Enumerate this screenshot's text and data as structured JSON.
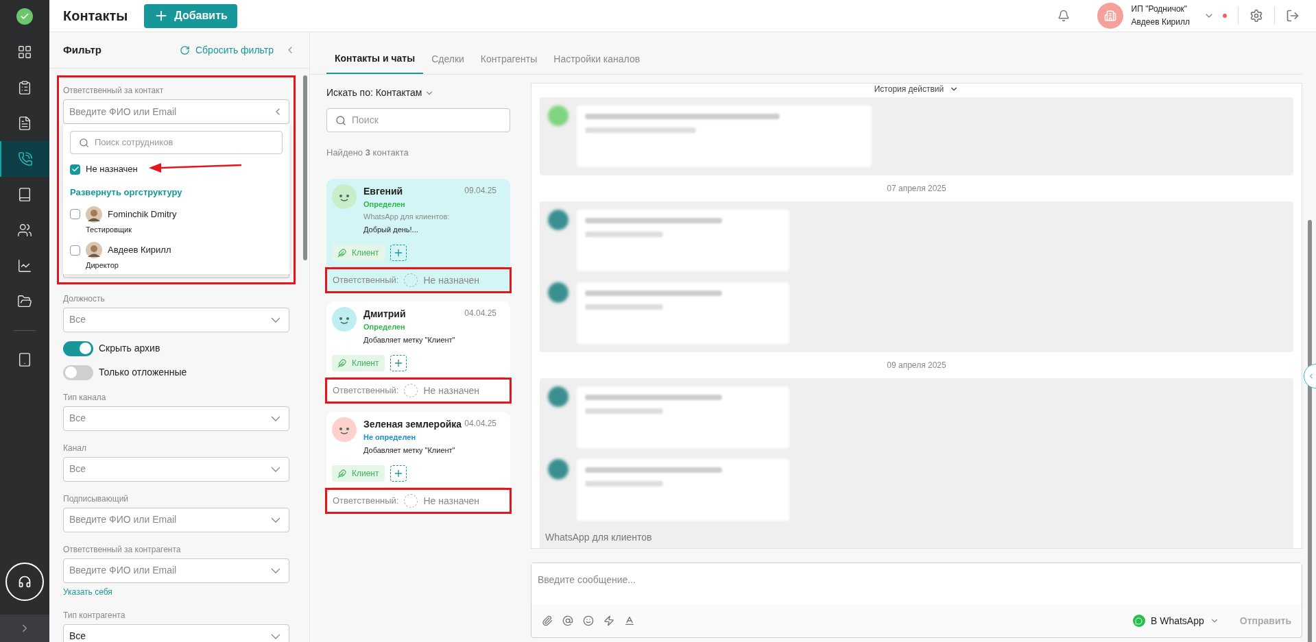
{
  "nav": [
    {
      "kind": "grid",
      "selected": false
    },
    {
      "kind": "clipboard",
      "selected": false
    },
    {
      "kind": "document",
      "selected": false
    },
    {
      "kind": "phone",
      "selected": true
    },
    {
      "kind": "book",
      "selected": false
    },
    {
      "kind": "people",
      "selected": false
    },
    {
      "kind": "chart",
      "selected": false
    },
    {
      "kind": "folder",
      "selected": false
    },
    {
      "kind": "tablet",
      "selected": false
    }
  ],
  "header": {
    "title": "Контакты",
    "add_button": "Добавить",
    "company": "ИП \"Родничок\"",
    "user": "Авдеев Кирилл",
    "notification_dot": true
  },
  "filter": {
    "title": "Фильтр",
    "reset": "Сбросить фильтр",
    "responsible": {
      "label": "Ответственный за контакт",
      "placeholder": "Введите ФИО или Email",
      "search_placeholder": "Поиск сотрудников",
      "unassigned": {
        "label": "Не назначен",
        "checked": true
      },
      "expand_link": "Развернуть оргструктуру",
      "employees": [
        {
          "name": "Fominchik Dmitry",
          "role": "Тестировщик",
          "checked": false
        },
        {
          "name": "Авдеев Кирилл",
          "role": "Директор",
          "checked": false
        }
      ]
    },
    "fields": [
      {
        "kind": "select",
        "label": "Должность",
        "value": "Все"
      },
      {
        "kind": "toggle",
        "label": "Скрыть архив",
        "on": true
      },
      {
        "kind": "toggle",
        "label": "Только отложенные",
        "on": false
      },
      {
        "kind": "select",
        "label": "Тип канала",
        "value": "Все"
      },
      {
        "kind": "select",
        "label": "Канал",
        "value": "Все"
      },
      {
        "kind": "user",
        "label": "Подписывающий",
        "placeholder": "Введите ФИО или Email"
      },
      {
        "kind": "user",
        "label": "Ответственный за контрагента",
        "placeholder": "Введите ФИО или Email",
        "link": "Указать себя"
      },
      {
        "kind": "select",
        "label": "Тип контрагента",
        "value": "Все"
      }
    ]
  },
  "tabs": [
    {
      "label": "Контакты и чаты",
      "selected": true
    },
    {
      "label": "Сделки",
      "selected": false
    },
    {
      "label": "Контрагенты",
      "selected": false
    },
    {
      "label": "Настройки каналов",
      "selected": false
    }
  ],
  "search_by": "Искать по: Контактам",
  "search_placeholder": "Поиск",
  "found": "Найдено **3** контакта",
  "contacts": [
    {
      "name": "Евгений",
      "status": {
        "text": "Определен",
        "color": "#2fb84a"
      },
      "channel": "WhatsApp для клиентов:",
      "preview": "Добрый день!...",
      "date": "09.04.25",
      "selected": true,
      "avatar": {
        "color": "#c9ecc9"
      },
      "tag": "Клиент",
      "responsible_label": "Ответственный:",
      "responsible": "Не назначен"
    },
    {
      "name": "Дмитрий",
      "status": {
        "text": "Определен",
        "color": "#2fb84a"
      },
      "preview": "Добавляет метку \"Клиент\"",
      "date": "04.04.25",
      "selected": false,
      "avatar": {
        "color": "#bfeef2"
      },
      "tag": "Клиент",
      "responsible_label": "Ответственный:",
      "responsible": "Не назначен"
    },
    {
      "name": "Зеленая землеройка",
      "status": {
        "text": "Не определен",
        "color": "#1a8fc7"
      },
      "preview": "Добавляет метку \"Клиент\"",
      "date": "04.04.25",
      "selected": false,
      "avatar": {
        "color": "#ffd0cc"
      },
      "tag": "Клиент",
      "responsible_label": "Ответственный:",
      "responsible": "Не назначен"
    }
  ],
  "chat": {
    "history": "История действий",
    "groups": [
      {
        "messages": [
          {
            "kind": "green"
          }
        ]
      },
      {
        "date": "07 апреля 2025",
        "messages": [
          {
            "kind": "teal"
          },
          {
            "kind": "teal"
          }
        ]
      },
      {
        "date": "09 апреля 2025",
        "messages": [
          {
            "kind": "teal"
          },
          {
            "kind": "teal"
          }
        ],
        "channel": "WhatsApp для клиентов"
      }
    ],
    "composer_placeholder": "Введите сообщение...",
    "channel_button": "В WhatsApp",
    "send": "Отправить"
  }
}
